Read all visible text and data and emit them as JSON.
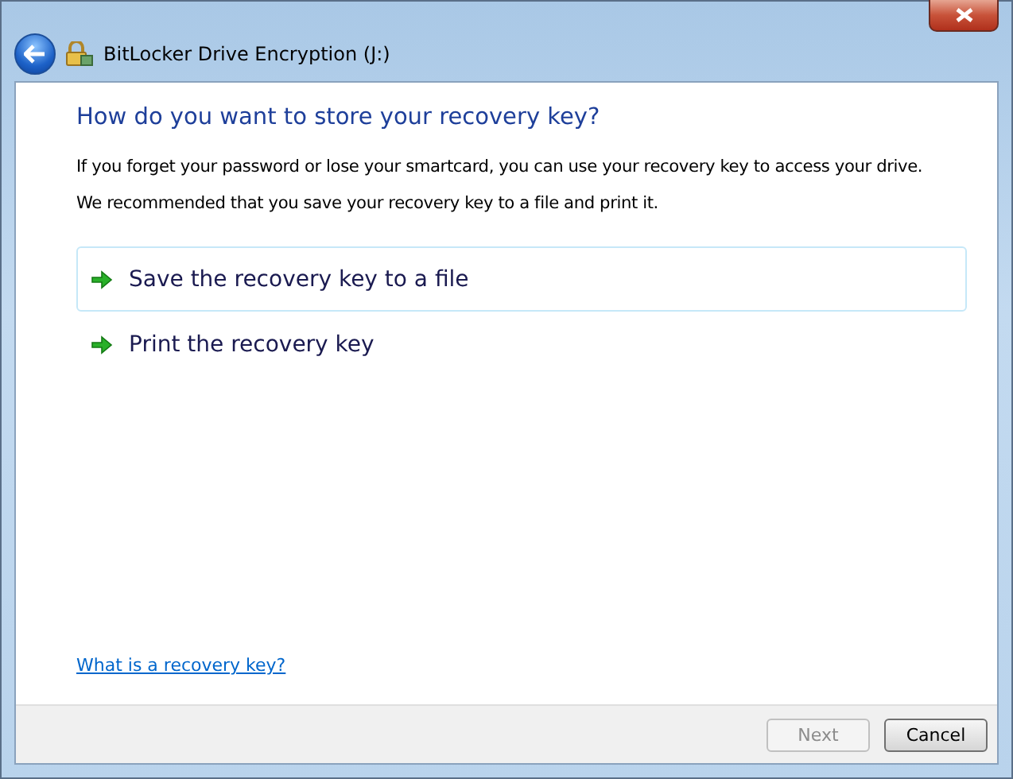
{
  "window": {
    "title": "BitLocker Drive Encryption (J:)"
  },
  "heading": "How do you want to store your recovery key?",
  "paragraphs": [
    "If you forget your password or lose your smartcard, you can use your recovery key to access your drive.",
    "We recommended that you save your recovery key to a file and print it."
  ],
  "options": [
    {
      "label": "Save the recovery key to a file",
      "hovered": true
    },
    {
      "label": "Print the recovery key",
      "hovered": false
    }
  ],
  "help_link": "What is a recovery key?",
  "buttons": [
    {
      "label": "Next",
      "disabled": true
    },
    {
      "label": "Cancel",
      "disabled": false
    }
  ]
}
